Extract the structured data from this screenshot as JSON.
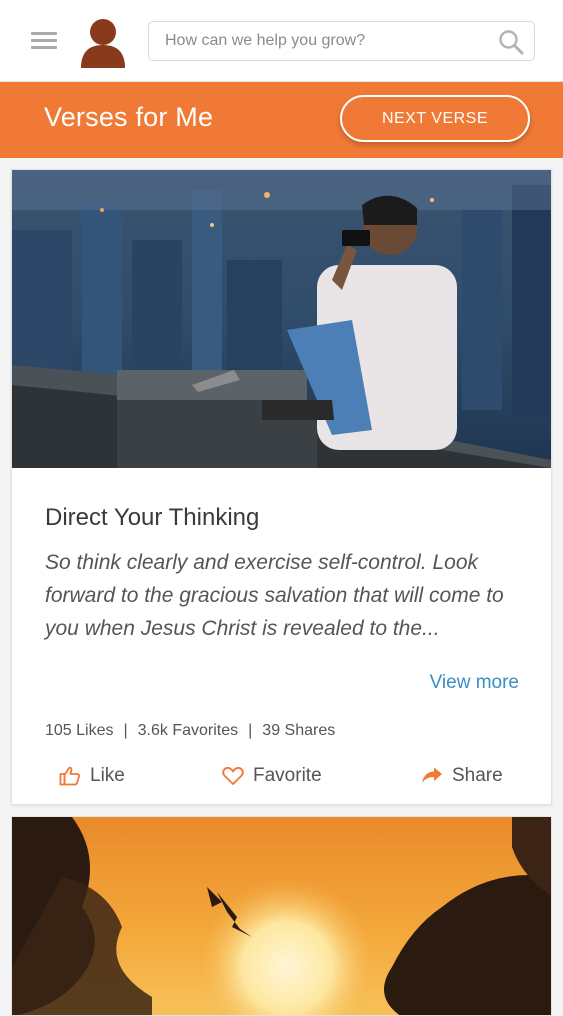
{
  "header": {
    "search": {
      "placeholder": "How can we help you grow?"
    }
  },
  "banner": {
    "title": "Verses for Me",
    "next_button": "NEXT VERSE"
  },
  "verse_card": {
    "title": "Direct Your Thinking",
    "text": "So think clearly and exercise self-control. Look forward to the gracious salvation that will come to you when Jesus Christ is revealed to the...",
    "view_more": "View more",
    "stats": {
      "likes": "105 Likes",
      "favorites": "3.6k Favorites",
      "shares": "39 Shares",
      "separator": "|"
    },
    "actions": {
      "like": "Like",
      "favorite": "Favorite",
      "share": "Share"
    }
  },
  "icons": {
    "menu": "hamburger-menu-icon",
    "avatar": "user-avatar-icon",
    "search": "search-icon",
    "like": "thumbs-up-icon",
    "favorite": "heart-icon",
    "share": "share-arrow-icon"
  },
  "colors": {
    "accent": "#f07a35",
    "link": "#3a8dc5",
    "avatar": "#8a3a1c"
  }
}
